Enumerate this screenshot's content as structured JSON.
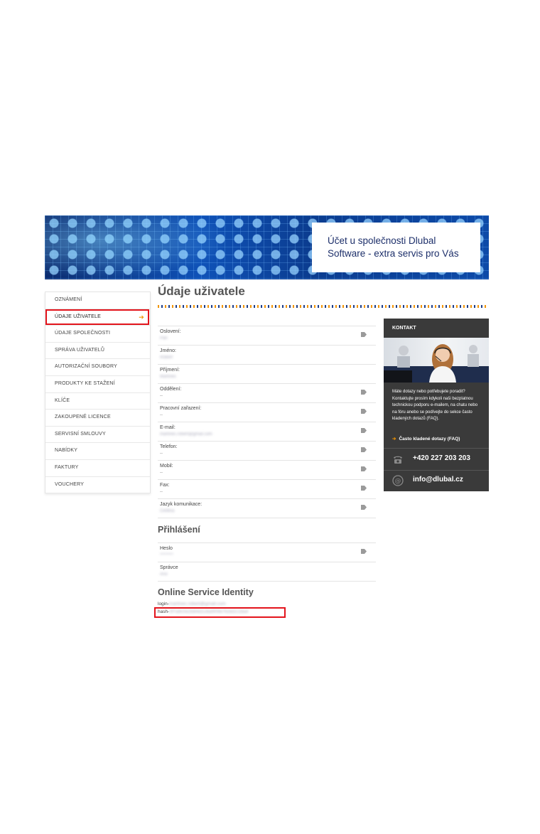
{
  "banner": {
    "title": "Účet u společnosti Dlubal\nSoftware - extra servis pro Vás"
  },
  "sidebar": {
    "items": [
      {
        "label": "OZNÁMENÍ"
      },
      {
        "label": "ÚDAJE UŽIVATELE",
        "active": true
      },
      {
        "label": "ÚDAJE SPOLEČNOSTI"
      },
      {
        "label": "SPRÁVA UŽIVATELŮ"
      },
      {
        "label": "AUTORIZAČNÍ SOUBORY"
      },
      {
        "label": "PRODUKTY KE STAŽENÍ"
      },
      {
        "label": "KLÍČE"
      },
      {
        "label": "ZAKOUPENÉ LICENCE"
      },
      {
        "label": "SERVISNÍ SMLOUVY"
      },
      {
        "label": "NABÍDKY"
      },
      {
        "label": "FAKTURY"
      },
      {
        "label": "VOUCHERY"
      }
    ],
    "active_arrow": "➔"
  },
  "main": {
    "title": "Údaje uživatele",
    "fields": [
      {
        "label": "Oslovení:",
        "value": "Pan",
        "blurred": true
      },
      {
        "label": "Jméno:",
        "value": "Robert",
        "blurred": true
      },
      {
        "label": "Příjmení:",
        "value": "Martinec",
        "blurred": true
      },
      {
        "label": "Oddělení:",
        "value": "--",
        "blurred": false
      },
      {
        "label": "Pracovní zařazení:",
        "value": "--",
        "blurred": false
      },
      {
        "label": "E-mail:",
        "value": "martinec.robert@gmail.com",
        "blurred": true
      },
      {
        "label": "Telefon:",
        "value": "--",
        "blurred": false
      },
      {
        "label": "Mobil:",
        "value": "--",
        "blurred": false
      },
      {
        "label": "Fax:",
        "value": "--",
        "blurred": false
      },
      {
        "label": "Jazyk komunikace:",
        "value": "Čeština",
        "blurred": true
      }
    ],
    "login_section": {
      "title": "Přihlášení",
      "fields": [
        {
          "label": "Heslo",
          "value": "********",
          "blurred": true
        },
        {
          "label": "Správce",
          "value": "Ano",
          "blurred": true
        }
      ]
    },
    "osi": {
      "title": "Online Service Identity",
      "login_prefix": "login-",
      "login_value": "martinec.robert@gmail.com",
      "hash_prefix": "hash-",
      "hash_value": "3f7a9c0e2b84d1c6a5f09e7b3d2c18a4"
    }
  },
  "contact": {
    "heading": "KONTAKT",
    "text": "Máte dotazy nebo potřebujete poradit? Kontaktujte prosím kdykoli naši bezplatnou technickou podporu e-mailem, na chatu nebo na fóru anebo se podívejte do sekce často kladených dotazů (FAQ).",
    "faq_link": "Často kladené dotazy (FAQ)",
    "phone": "+420 227 203 203",
    "email": "info@dlubal.cz"
  },
  "colors": {
    "accent": "#f29400",
    "brand_blue": "#1d3e8a",
    "highlight_red": "#e3141c",
    "contact_bg": "#3a3a3a"
  }
}
